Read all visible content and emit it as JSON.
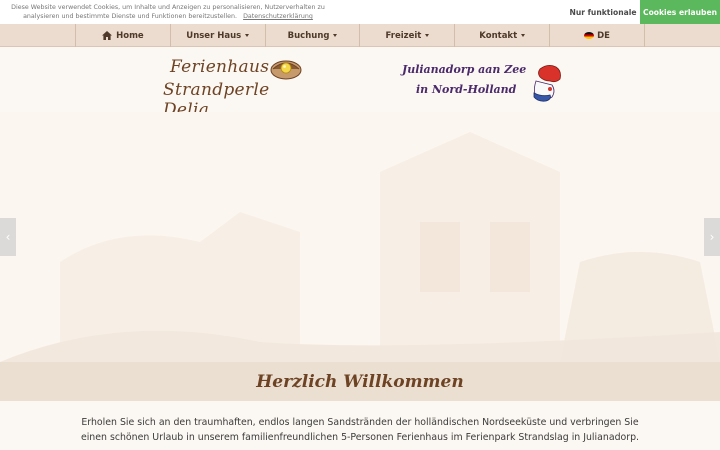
{
  "cookie": {
    "text": "Diese Website verwendet Cookies, um Inhalte und Anzeigen zu personalisieren, Nutzerverhalten zu analysieren und bestimmte Dienste und Funktionen bereitzustellen.",
    "privacy_link": "Datenschutzerklärung",
    "functional_button": "Nur funktionale",
    "allow_button": "Cookies erlauben",
    "allow_color": "#5cb85c"
  },
  "nav": {
    "items": [
      {
        "label": "Home",
        "icon": "home-icon"
      },
      {
        "label": "Unser Haus",
        "dropdown": true
      },
      {
        "label": "Buchung",
        "dropdown": true
      },
      {
        "label": "Freizeit",
        "dropdown": true
      },
      {
        "label": "Kontakt",
        "dropdown": true
      },
      {
        "label": "DE",
        "icon": "german-flag-icon"
      }
    ]
  },
  "logos": {
    "left_line1": "Ferienhaus",
    "left_line2": "Strandperle Delia",
    "right_line1": "Julianadorp aan Zee",
    "right_line2": "in Nord-Holland"
  },
  "slider": {
    "prev": "‹",
    "next": "›"
  },
  "welcome": {
    "title": "Herzlich Willkommen",
    "text": "Erholen Sie sich an den traumhaften, endlos langen Sandstränden der holländischen Nordseeküste und verbringen Sie einen schönen Urlaub in unserem familienfreundlichen 5-Personen Ferienhaus im Ferienpark Strandslag in Julianadorp."
  },
  "colors": {
    "nav_bg": "#ebdccf",
    "brown": "#6e4324",
    "band_bg": "#ebdfd2"
  }
}
